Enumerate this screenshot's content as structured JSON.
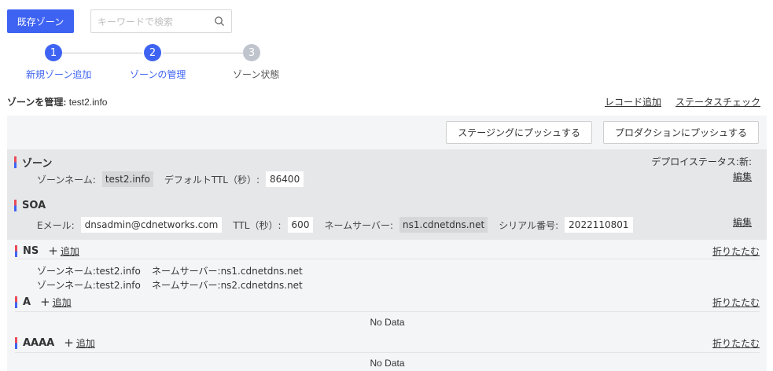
{
  "toolbar": {
    "existing_zone_label": "既存ゾーン",
    "search_placeholder": "キーワードで検索"
  },
  "steps": [
    {
      "number": "1",
      "label": "新規ゾーン追加",
      "state": "done"
    },
    {
      "number": "2",
      "label": "ゾーンの管理",
      "state": "active"
    },
    {
      "number": "3",
      "label": "ゾーン状態",
      "state": "pending"
    }
  ],
  "manage": {
    "prefix": "ゾーンを管理:",
    "zone": "test2.info"
  },
  "links": {
    "add_record": "レコード追加",
    "status_check": "ステータスチェック"
  },
  "push": {
    "staging": "ステージングにプッシュする",
    "production": "プロダクションにプッシュする"
  },
  "zone_section": {
    "title": "ゾーン",
    "deploy_status": "デプロイステータス:新:",
    "zone_name_label": "ゾーンネーム:",
    "zone_name": "test2.info",
    "ttl_label": "デフォルトTTL（秒）:",
    "ttl": "86400",
    "edit": "編集"
  },
  "soa_section": {
    "title": "SOA",
    "email_label": "Eメール:",
    "email": "dnsadmin@cdnetworks.com",
    "ttl_label": "TTL（秒）:",
    "ttl": "600",
    "ns_label": "ネームサーバー:",
    "ns": "ns1.cdnetdns.net",
    "serial_label": "シリアル番号:",
    "serial": "2022110801",
    "edit": "編集"
  },
  "records": {
    "add_label": "追加",
    "fold_label": "折りたたむ",
    "no_data": "No Data",
    "ns": {
      "name": "NS",
      "rows": [
        {
          "zone": "ゾーンネーム:test2.info",
          "server": "ネームサーバー:ns1.cdnetdns.net"
        },
        {
          "zone": "ゾーンネーム:test2.info",
          "server": "ネームサーバー:ns2.cdnetdns.net"
        }
      ]
    },
    "a": {
      "name": "A"
    },
    "aaaa": {
      "name": "AAAA"
    }
  },
  "colors": {
    "primary": "#3e63f2",
    "step_pending": "#c0c4cc",
    "bar_red": "#e94b5a"
  }
}
